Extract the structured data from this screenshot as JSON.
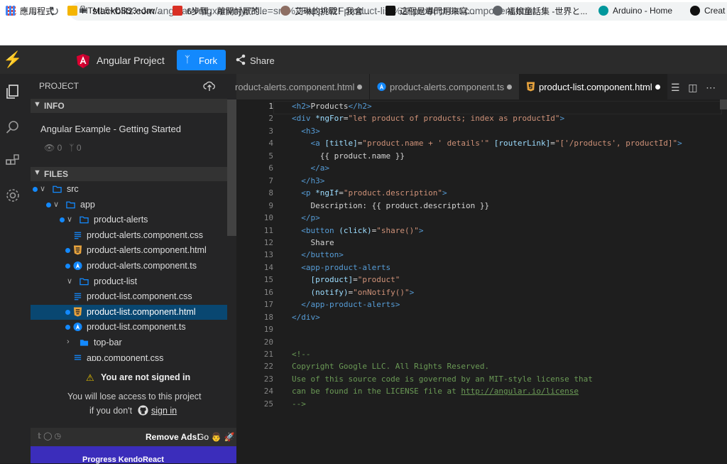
{
  "browser": {
    "url_host": "stackblitz.com",
    "url_path": "/angular/vmgxnnvnjyr?file=src%2Fapp%2Fproduct-list%2Fproduct-list.component.html",
    "bookmarks": [
      {
        "label": "應用程式",
        "color": "#4285f4"
      },
      {
        "label": "HTML5+CSS3+Jav...",
        "color": "#f4b400"
      },
      {
        "label": "6步驟，離開討厭的...",
        "color": "#d93025"
      },
      {
        "label": "艾琳的挑戰！我會...",
        "color": "#8d6e63"
      },
      {
        "label": "這個是專門用來寫...",
        "color": "#111111"
      },
      {
        "label": "福娘童話集 -世界と...",
        "color": "#5f6368"
      },
      {
        "label": "Arduino - Home",
        "color": "#00979c"
      },
      {
        "label": "Creat",
        "color": "#111111"
      }
    ]
  },
  "header": {
    "project_title": "Angular Project",
    "fork_label": "Fork",
    "share_label": "Share"
  },
  "sidebar": {
    "project_label": "PROJECT",
    "info_label": "INFO",
    "info_title": "Angular Example - Getting Started",
    "views": "0",
    "forks": "0",
    "files_label": "FILES",
    "tree": [
      {
        "name": "src",
        "type": "folder",
        "depth": 0,
        "open": true,
        "dot": true
      },
      {
        "name": "app",
        "type": "folder",
        "depth": 1,
        "open": true,
        "dot": true
      },
      {
        "name": "product-alerts",
        "type": "folder",
        "depth": 2,
        "open": true,
        "dot": true
      },
      {
        "name": "product-alerts.component.css",
        "type": "css",
        "depth": 3,
        "dot": false
      },
      {
        "name": "product-alerts.component.html",
        "type": "html",
        "depth": 3,
        "dot": true
      },
      {
        "name": "product-alerts.component.ts",
        "type": "ts",
        "depth": 3,
        "dot": true
      },
      {
        "name": "product-list",
        "type": "folder",
        "depth": 2,
        "open": true,
        "dot": false
      },
      {
        "name": "product-list.component.css",
        "type": "css",
        "depth": 3,
        "dot": false
      },
      {
        "name": "product-list.component.html",
        "type": "html",
        "depth": 3,
        "dot": true,
        "selected": true
      },
      {
        "name": "product-list.component.ts",
        "type": "ts",
        "depth": 3,
        "dot": true
      },
      {
        "name": "top-bar",
        "type": "folder",
        "depth": 2,
        "open": false,
        "dot": false
      },
      {
        "name": "app.component.css",
        "type": "css",
        "depth": 2,
        "dot": false
      }
    ],
    "signin_warning": "You are not signed in",
    "signin_line1": "You will lose access to this project",
    "signin_line2": "if you don't",
    "signin_link": "sign in",
    "remove_ads": "Remove Ads!",
    "go_label": "Go",
    "ad_text": "Progress KendoReact"
  },
  "tabs": [
    {
      "label": "roduct-alerts.component.html",
      "icon": "none",
      "modified": true,
      "active": false
    },
    {
      "label": "product-alerts.component.ts",
      "icon": "angular-icon",
      "modified": true,
      "active": false
    },
    {
      "label": "product-list.component.html",
      "icon": "html5-icon",
      "modified": true,
      "active": true
    }
  ],
  "colors": {
    "accent": "#1389fd",
    "selected_row": "#094771",
    "editor_bg": "#1e1e1e",
    "sidebar_bg": "#252526"
  },
  "editor": {
    "current_line": "1",
    "lines": [
      [
        [
          "tg",
          "<h2>"
        ],
        [
          "pl",
          "Products"
        ],
        [
          "tg",
          "</h2>"
        ]
      ],
      [
        [
          "tg",
          "<div "
        ],
        [
          "at",
          "*ngFor"
        ],
        [
          "pl",
          "="
        ],
        [
          "st",
          "\"let product of products; index as productId\""
        ],
        [
          "tg",
          ">"
        ]
      ],
      [
        [
          "pl",
          "  "
        ],
        [
          "tg",
          "<h3>"
        ]
      ],
      [
        [
          "pl",
          "    "
        ],
        [
          "tg",
          "<a "
        ],
        [
          "at",
          "[title]"
        ],
        [
          "pl",
          "="
        ],
        [
          "st",
          "\"product.name + ' details'\""
        ],
        [
          "pl",
          " "
        ],
        [
          "at",
          "[routerLink]"
        ],
        [
          "pl",
          "="
        ],
        [
          "st",
          "\"['/products', productId]\""
        ],
        [
          "tg",
          ">"
        ]
      ],
      [
        [
          "pl",
          "      {{ product.name }}"
        ]
      ],
      [
        [
          "pl",
          "    "
        ],
        [
          "tg",
          "</a>"
        ]
      ],
      [
        [
          "pl",
          "  "
        ],
        [
          "tg",
          "</h3>"
        ]
      ],
      [
        [
          "pl",
          "  "
        ],
        [
          "tg",
          "<p "
        ],
        [
          "at",
          "*ngIf"
        ],
        [
          "pl",
          "="
        ],
        [
          "st",
          "\"product.description\""
        ],
        [
          "tg",
          ">"
        ]
      ],
      [
        [
          "pl",
          "    Description: {{ product.description }}"
        ]
      ],
      [
        [
          "pl",
          "  "
        ],
        [
          "tg",
          "</p>"
        ]
      ],
      [
        [
          "pl",
          "  "
        ],
        [
          "tg",
          "<button "
        ],
        [
          "at",
          "(click)"
        ],
        [
          "pl",
          "="
        ],
        [
          "st",
          "\"share()\""
        ],
        [
          "tg",
          ">"
        ]
      ],
      [
        [
          "pl",
          "    Share"
        ]
      ],
      [
        [
          "pl",
          "  "
        ],
        [
          "tg",
          "</button>"
        ]
      ],
      [
        [
          "pl",
          "  "
        ],
        [
          "tg",
          "<app-product-alerts"
        ]
      ],
      [
        [
          "pl",
          "    "
        ],
        [
          "at",
          "[product]"
        ],
        [
          "pl",
          "="
        ],
        [
          "st",
          "\"product\""
        ]
      ],
      [
        [
          "pl",
          "    "
        ],
        [
          "at",
          "(notify)"
        ],
        [
          "pl",
          "="
        ],
        [
          "st",
          "\"onNotify()\""
        ],
        [
          "tg",
          ">"
        ]
      ],
      [
        [
          "pl",
          "  "
        ],
        [
          "tg",
          "</app-product-alerts>"
        ]
      ],
      [
        [
          "tg",
          "</div>"
        ]
      ],
      [],
      [],
      [
        [
          "cm",
          "<!--"
        ]
      ],
      [
        [
          "cm",
          "Copyright Google LLC. All Rights Reserved."
        ]
      ],
      [
        [
          "cm",
          "Use of this source code is governed by an MIT-style license that"
        ]
      ],
      [
        [
          "cm",
          "can be found in the LICENSE file at "
        ],
        [
          "cmul",
          "http://angular.io/license"
        ]
      ],
      [
        [
          "cm",
          "-->"
        ]
      ]
    ]
  }
}
